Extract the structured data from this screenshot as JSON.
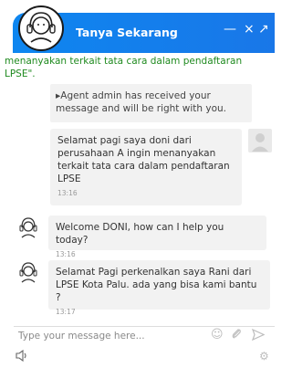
{
  "header": {
    "title": "Tanya Sekarang",
    "minimize": "—",
    "close": "×",
    "expand": "↗"
  },
  "top_text": "menanyakan terkait tata cara dalam pendaftaran LPSE\".",
  "system_message": "▸Agent admin has received your message and will be right with you.",
  "messages": [
    {
      "text": "Selamat pagi saya doni dari perusahaan A ingin menanyakan terkait tata cara dalam pendaftaran LPSE",
      "time": "13:16",
      "sender": "user"
    },
    {
      "text": "Welcome DONI, how can I help you today?",
      "time": "13:16",
      "sender": "agent"
    },
    {
      "text": "Selamat Pagi perkenalkan saya Rani dari LPSE Kota Palu. ada yang bisa kami bantu ?",
      "time": "13:17",
      "sender": "agent"
    }
  ],
  "input": {
    "placeholder": "Type your message here..."
  },
  "icons": [
    "emoji-icon",
    "attach-icon",
    "send-icon",
    "speaker-icon",
    "settings-icon"
  ],
  "colors": {
    "header": "#1977e8",
    "top_text": "#1f8a1f",
    "bubble": "#f2f2f2"
  }
}
